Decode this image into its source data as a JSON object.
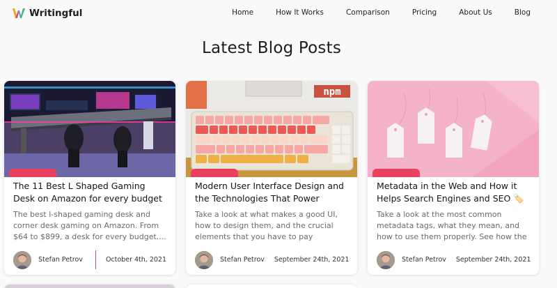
{
  "brand": {
    "name": "Writingful"
  },
  "nav": {
    "items": [
      "Home",
      "How It Works",
      "Comparison",
      "Pricing",
      "About Us",
      "Blog"
    ]
  },
  "section": {
    "title": "Latest Blog Posts"
  },
  "posts": [
    {
      "title": "The 11 Best L Shaped Gaming Desk on Amazon for every budget 🎮",
      "excerpt": "The best l-shaped gaming desk and corner desk gaming on Amazon. From $64 to $899, a desk for every budget....",
      "author": "Stefan Petrov",
      "date": "October 4th, 2021",
      "image_icon": "gaming-desk-image"
    },
    {
      "title": "Modern User Interface Design and the Technologies That Power Them...",
      "excerpt": "Take a look at what makes a good UI, how to design them, and the crucial elements that you have to pay attention to. A quick...",
      "author": "Stefan Petrov",
      "date": "September 24th, 2021",
      "image_icon": "keyboard-npm-image"
    },
    {
      "title": "Metadata in the Web and How it Helps Search Engines and SEO 🏷️",
      "excerpt": "Take a look at the most common metadata tags, what they mean, and how to use them properly. See how the web...",
      "author": "Stefan Petrov",
      "date": "September 24th, 2021",
      "image_icon": "tags-image"
    }
  ],
  "colors": {
    "accent": "#e94060",
    "background": "#fafafa",
    "card": "#ffffff"
  }
}
